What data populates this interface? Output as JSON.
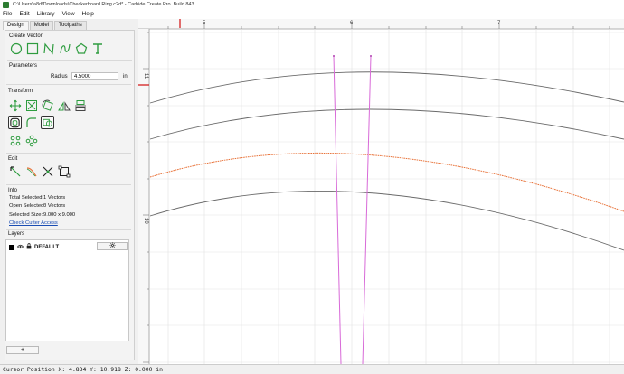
{
  "window": {
    "title": "C:\\Users\\a8d\\Downloads\\Checkerboard Ring.c2d* - Carbide Create Pro. Build 843"
  },
  "menu": [
    "File",
    "Edit",
    "Library",
    "View",
    "Help"
  ],
  "tabs": [
    "Design",
    "Model",
    "Toolpaths"
  ],
  "sections": {
    "create_vector": "Create Vector",
    "parameters": "Parameters",
    "transform": "Transform",
    "edit": "Edit",
    "info": "Info",
    "layers": "Layers"
  },
  "parameters": {
    "radius_label": "Radius",
    "radius_value": "4.5000",
    "unit": "in"
  },
  "info": {
    "total_selected_label": "Total Selected:",
    "total_selected_value": "1 Vectors",
    "open_selected_label": "Open Selected:",
    "open_selected_value": "0 Vectors",
    "selected_size_label": "Selected Size:",
    "selected_size_value": "9.000 x 9.000",
    "check_cutter_link": "Check Cutter Access"
  },
  "layers": {
    "name": "DEFAULT",
    "add_button": "+"
  },
  "ruler": {
    "top_labels": [
      "5",
      "6",
      "7"
    ],
    "left_labels": [
      "11",
      "10"
    ]
  },
  "status": {
    "cursor_position": "Cursor Position X: 4.834 Y: 10.918 Z: 0.000 in"
  },
  "icons": {
    "create": [
      "circle-icon",
      "rectangle-icon",
      "polyline-icon",
      "curve-icon",
      "polygon-icon",
      "text-icon"
    ],
    "transform_row1": [
      "move-icon",
      "scale-icon",
      "rotate-icon",
      "mirror-icon",
      "align-icon"
    ],
    "transform_row2": [
      "offset-icon",
      "fillet-icon",
      "boolean-icon"
    ],
    "transform_row3": [
      "circular-array-icon",
      "grid-array-icon"
    ],
    "edit": [
      "node-edit-icon",
      "smooth-curve-icon",
      "trim-icon",
      "bounding-box-icon"
    ]
  },
  "colors": {
    "accent_green": "#2e9c3f",
    "arc_gray": "#6a6a6a",
    "arc_orange": "#e8733a",
    "line_magenta": "#d86ad8",
    "ruler_marker_red": "#d32020",
    "link_blue": "#1a4db3"
  }
}
